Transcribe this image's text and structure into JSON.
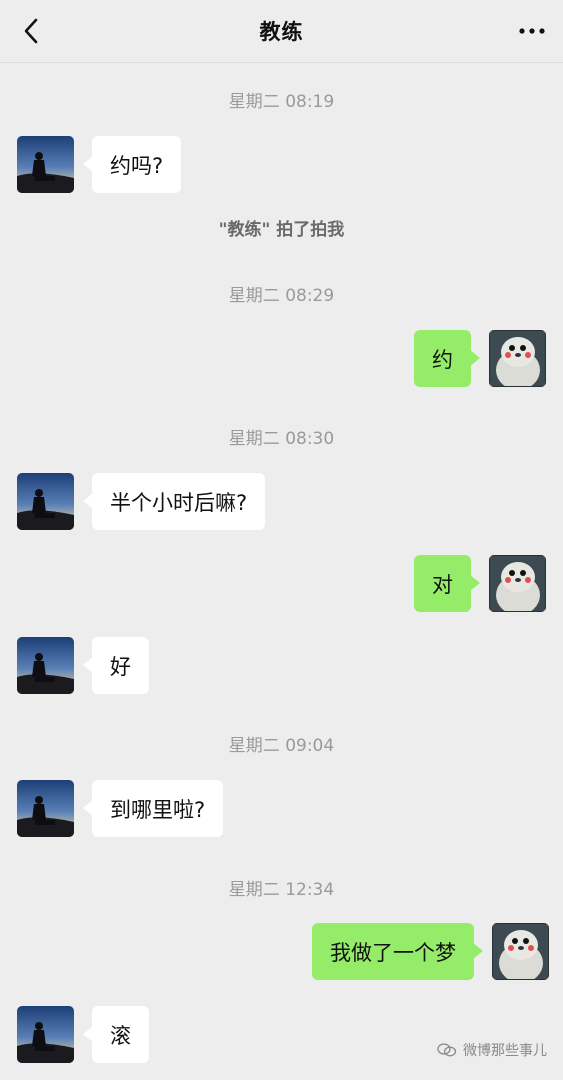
{
  "header": {
    "title": "教练",
    "back_icon": "chevron-left-icon",
    "more_icon": "ellipsis-icon"
  },
  "messages": [
    {
      "kind": "time",
      "text": "星期二 08:19"
    },
    {
      "kind": "in",
      "text": "约吗?"
    },
    {
      "kind": "system",
      "text": "\"教练\" 拍了拍我"
    },
    {
      "kind": "time",
      "text": "星期二 08:29"
    },
    {
      "kind": "out",
      "text": "约"
    },
    {
      "kind": "time",
      "text": "星期二 08:30"
    },
    {
      "kind": "in",
      "text": "半个小时后嘛?"
    },
    {
      "kind": "out",
      "text": "对"
    },
    {
      "kind": "in",
      "text": "好"
    },
    {
      "kind": "time",
      "text": "星期二 09:04"
    },
    {
      "kind": "in",
      "text": "到哪里啦?"
    },
    {
      "kind": "time",
      "text": "星期二 12:34"
    },
    {
      "kind": "out",
      "text": "我做了一个梦"
    },
    {
      "kind": "in",
      "text": "滚"
    }
  ],
  "watermark": {
    "text": "微博那些事儿",
    "icon": "wechat-official-account-icon"
  },
  "colors": {
    "background": "#ededed",
    "outgoing_bubble": "#95ec69",
    "incoming_bubble": "#ffffff"
  }
}
